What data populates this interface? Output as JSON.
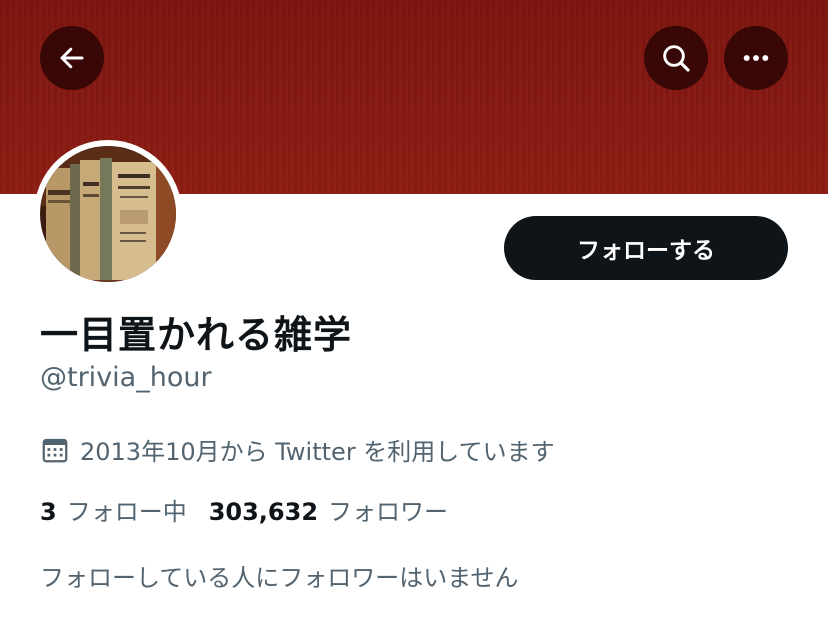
{
  "header": {
    "back_icon": "arrow-left-icon",
    "search_icon": "search-icon",
    "more_icon": "more-horizontal-icon",
    "banner_color": "#861a12"
  },
  "profile": {
    "name": "一目置かれる雑学",
    "handle": "@trivia_hour",
    "joined": "2013年10月から Twitter を利用しています",
    "follow_label": "フォローする"
  },
  "stats": {
    "following_count": "3",
    "following_label": "フォロー中",
    "followers_count": "303,632",
    "followers_label": "フォロワー"
  },
  "mutual_text": "フォローしている人にフォロワーはいません"
}
